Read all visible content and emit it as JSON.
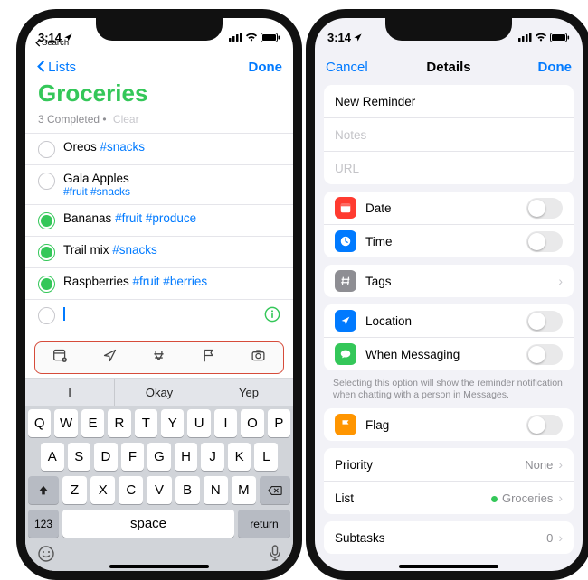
{
  "left": {
    "status": {
      "time": "3:14",
      "back": "Search"
    },
    "nav": {
      "back": "Lists",
      "done": "Done"
    },
    "list": {
      "title": "Groceries",
      "completed": "3 Completed",
      "clear": "Clear"
    },
    "items": [
      {
        "title": "Oreos",
        "tags": "#snacks"
      },
      {
        "title": "Gala Apples",
        "tags": "#fruit #snacks"
      },
      {
        "title": "Bananas",
        "tags": "#fruit #produce"
      },
      {
        "title": "Trail mix",
        "tags": "#snacks"
      },
      {
        "title": "Raspberries",
        "tags": "#fruit #berries"
      }
    ],
    "keyboard": {
      "pred": [
        "I",
        "Okay",
        "Yep"
      ],
      "r1": [
        "Q",
        "W",
        "E",
        "R",
        "T",
        "Y",
        "U",
        "I",
        "O",
        "P"
      ],
      "r2": [
        "A",
        "S",
        "D",
        "F",
        "G",
        "H",
        "J",
        "K",
        "L"
      ],
      "r3": [
        "Z",
        "X",
        "C",
        "V",
        "B",
        "N",
        "M"
      ],
      "fn": {
        "num": "123",
        "space": "space",
        "ret": "return"
      }
    }
  },
  "right": {
    "status": {
      "time": "3:14"
    },
    "nav": {
      "cancel": "Cancel",
      "title": "Details",
      "done": "Done"
    },
    "g1": {
      "title": "New Reminder",
      "notes": "Notes",
      "url": "URL"
    },
    "rows": {
      "date": "Date",
      "time": "Time",
      "tags": "Tags",
      "location": "Location",
      "messaging": "When Messaging",
      "flag": "Flag",
      "priority": "Priority",
      "list": "List",
      "subtasks": "Subtasks"
    },
    "values": {
      "priority": "None",
      "list": "Groceries",
      "subtasks": "0"
    },
    "footnote": "Selecting this option will show the reminder notification when chatting with a person in Messages."
  }
}
